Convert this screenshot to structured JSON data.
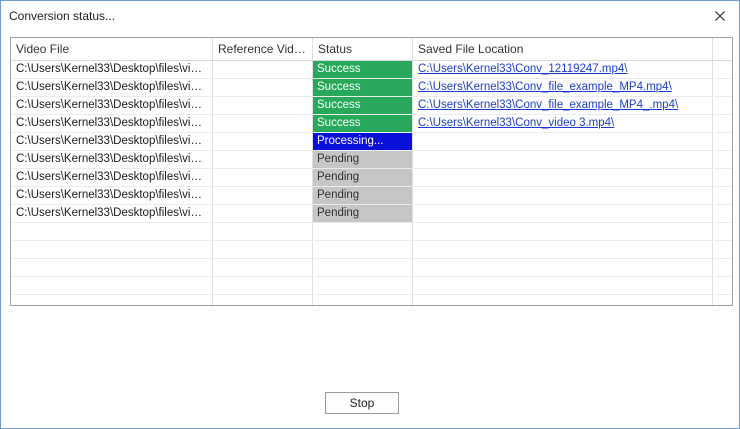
{
  "window": {
    "title": "Conversion status..."
  },
  "table": {
    "columns": [
      "Video File",
      "Reference Video...",
      "Status",
      "Saved File Location"
    ],
    "rows": [
      {
        "video_file": "C:\\Users\\Kernel33\\Desktop\\files\\vide...",
        "reference": "",
        "status": "Success",
        "status_type": "success",
        "saved_location": "C:\\Users\\Kernel33\\Conv_12119247.mp4\\"
      },
      {
        "video_file": "C:\\Users\\Kernel33\\Desktop\\files\\vide...",
        "reference": "",
        "status": "Success",
        "status_type": "success",
        "saved_location": "C:\\Users\\Kernel33\\Conv_file_example_MP4.mp4\\"
      },
      {
        "video_file": "C:\\Users\\Kernel33\\Desktop\\files\\vide...",
        "reference": "",
        "status": "Success",
        "status_type": "success",
        "saved_location": "C:\\Users\\Kernel33\\Conv_file_example_MP4_.mp4\\"
      },
      {
        "video_file": "C:\\Users\\Kernel33\\Desktop\\files\\vide...",
        "reference": "",
        "status": "Success",
        "status_type": "success",
        "saved_location": "C:\\Users\\Kernel33\\Conv_video 3.mp4\\"
      },
      {
        "video_file": "C:\\Users\\Kernel33\\Desktop\\files\\vide...",
        "reference": "",
        "status": "Processing...",
        "status_type": "processing",
        "saved_location": ""
      },
      {
        "video_file": "C:\\Users\\Kernel33\\Desktop\\files\\vide...",
        "reference": "",
        "status": "Pending",
        "status_type": "pending",
        "saved_location": ""
      },
      {
        "video_file": "C:\\Users\\Kernel33\\Desktop\\files\\vide...",
        "reference": "",
        "status": "Pending",
        "status_type": "pending",
        "saved_location": ""
      },
      {
        "video_file": "C:\\Users\\Kernel33\\Desktop\\files\\vide...",
        "reference": "",
        "status": "Pending",
        "status_type": "pending",
        "saved_location": ""
      },
      {
        "video_file": "C:\\Users\\Kernel33\\Desktop\\files\\vide...",
        "reference": "",
        "status": "Pending",
        "status_type": "pending",
        "saved_location": ""
      }
    ]
  },
  "buttons": {
    "stop_label": "Stop"
  },
  "icons": {
    "close": "close-icon"
  },
  "colors": {
    "success": "#27a85a",
    "processing": "#0a10d8",
    "pending": "#c6c6c6",
    "link": "#1a3ec9"
  }
}
